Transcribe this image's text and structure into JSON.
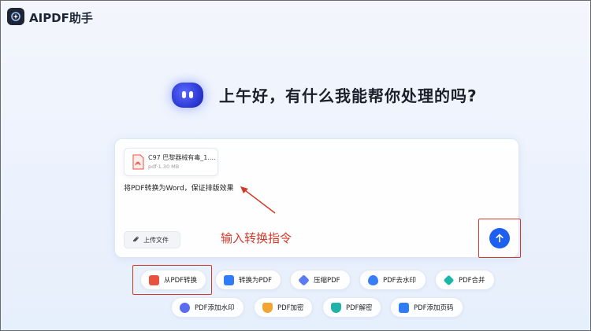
{
  "app": {
    "title": "AIPDF助手"
  },
  "greeting": "上午好，有什么我能帮你处理的吗?",
  "input": {
    "file": {
      "name": "C97 巴黎器械有毒_1....",
      "meta": "pdf·1.30 MB"
    },
    "prompt": "将PDF转换为Word，保证排版效果",
    "upload_label": "上传文件"
  },
  "annotation": {
    "text": "输入转换指令",
    "color": "#d23a2a"
  },
  "tools_row1": [
    {
      "label": "从PDF转换",
      "icon": "pdf-convert-icon",
      "color": "#e8533f"
    },
    {
      "label": "转换为PDF",
      "icon": "to-pdf-icon",
      "color": "#2f7cf6"
    },
    {
      "label": "压缩PDF",
      "icon": "compress-icon",
      "color": "#5b7cf0"
    },
    {
      "label": "PDF去水印",
      "icon": "remove-watermark-icon",
      "color": "#3a7ef5"
    },
    {
      "label": "PDF合并",
      "icon": "merge-icon",
      "color": "#1bb7a6"
    }
  ],
  "tools_row2": [
    {
      "label": "PDF添加水印",
      "icon": "add-watermark-icon",
      "color": "#5a6cf0"
    },
    {
      "label": "PDF加密",
      "icon": "encrypt-icon",
      "color": "#f2a531"
    },
    {
      "label": "PDF解密",
      "icon": "decrypt-icon",
      "color": "#22b3a8"
    },
    {
      "label": "PDF添加页码",
      "icon": "page-number-icon",
      "color": "#2f7cf6"
    }
  ],
  "colors": {
    "accent": "#1f5ff0",
    "annotation": "#d23a2a"
  }
}
